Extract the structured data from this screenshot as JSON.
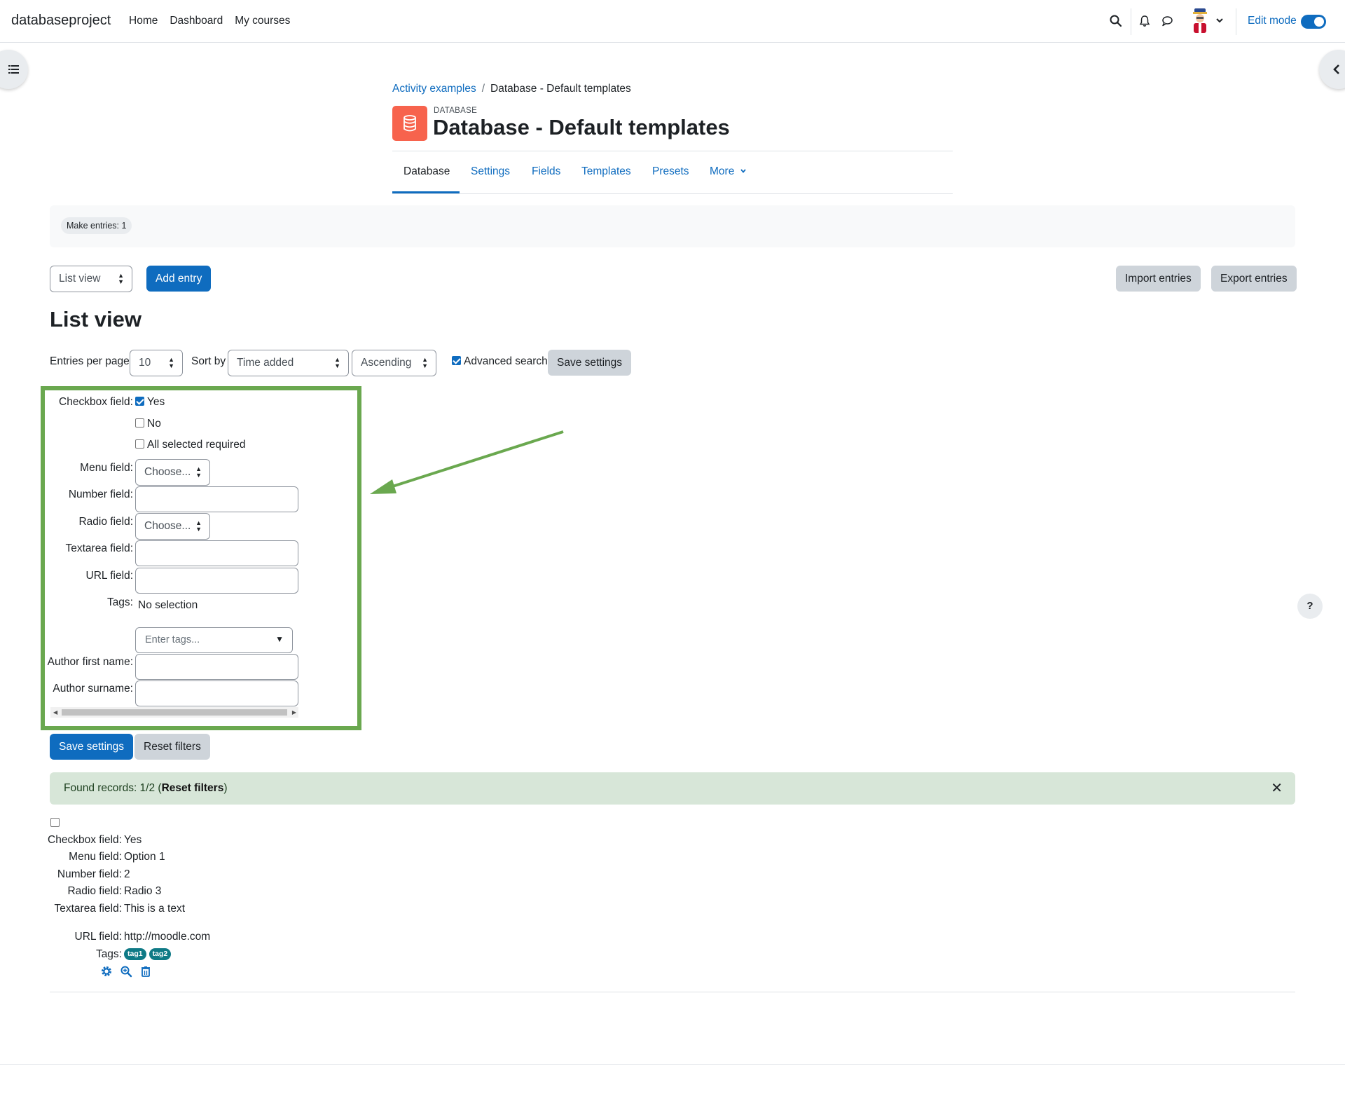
{
  "nav": {
    "brand": "databaseproject",
    "links": [
      "Home",
      "Dashboard",
      "My courses"
    ],
    "edit_mode_label": "Edit mode",
    "edit_mode_on": true
  },
  "breadcrumb": {
    "parent": "Activity examples",
    "separator": "/",
    "current": "Database - Default templates"
  },
  "module": {
    "kicker": "DATABASE",
    "title": "Database - Default templates",
    "icon": "database-icon",
    "icon_color": "#f7634d"
  },
  "tabs": [
    {
      "label": "Database",
      "active": true
    },
    {
      "label": "Settings"
    },
    {
      "label": "Fields"
    },
    {
      "label": "Templates"
    },
    {
      "label": "Presets"
    },
    {
      "label": "More"
    }
  ],
  "completion": {
    "pill": "Make entries: 1"
  },
  "toolbar": {
    "view_select": "List view",
    "add_entry": "Add entry",
    "import": "Import entries",
    "export": "Export entries"
  },
  "heading": "List view",
  "filters": {
    "per_page_label": "Entries per page",
    "per_page_value": "10",
    "sort_label": "Sort by",
    "sort_value": "Time added",
    "order_value": "Ascending",
    "advanced_label": "Advanced search",
    "advanced_checked": true,
    "save_settings": "Save settings"
  },
  "advanced": {
    "checkbox_label": "Checkbox field:",
    "checkbox_options": [
      {
        "label": "Yes",
        "checked": true
      },
      {
        "label": "No",
        "checked": false
      },
      {
        "label": "All selected required",
        "checked": false
      }
    ],
    "menu_label": "Menu field:",
    "menu_value": "Choose...",
    "number_label": "Number field:",
    "radio_label": "Radio field:",
    "radio_value": "Choose...",
    "textarea_label": "Textarea field:",
    "url_label": "URL field:",
    "tags_label": "Tags:",
    "tags_selection": "No selection",
    "tags_placeholder": "Enter tags...",
    "firstname_label": "Author first name:",
    "surname_label": "Author surname:"
  },
  "actions": {
    "save_settings": "Save settings",
    "reset_filters": "Reset filters"
  },
  "alert": {
    "text": "Found records: 1/2 (",
    "link": "Reset filters",
    "end": ")",
    "color": "#d7e6d8"
  },
  "entry": {
    "rows": [
      {
        "label": "Checkbox field:",
        "value": "Yes"
      },
      {
        "label": "Menu field:",
        "value": "Option 1"
      },
      {
        "label": "Number field:",
        "value": "2"
      },
      {
        "label": "Radio field:",
        "value": "Radio 3"
      },
      {
        "label": "Textarea field:",
        "value": "This is a text"
      }
    ],
    "url_label": "URL field:",
    "url_value": "http://moodle.com",
    "tags_label": "Tags:",
    "tags": [
      "tag1",
      "tag2"
    ]
  },
  "help": "?",
  "colors": {
    "primary": "#0f6cbf",
    "annotation": "#6aa84f",
    "tag": "#0f7a86"
  }
}
